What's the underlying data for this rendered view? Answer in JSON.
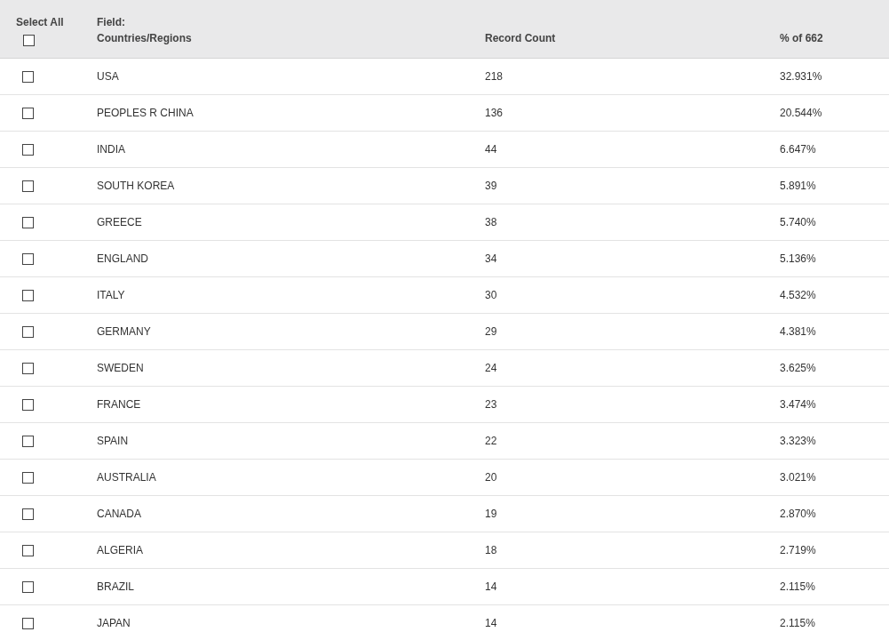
{
  "header": {
    "select_all": {
      "label": "Select All",
      "checked": false
    },
    "field_label": "Field:",
    "field_name": "Countries/Regions",
    "count_label": "Record Count",
    "percent_label": "% of 662"
  },
  "rows": [
    {
      "name": "USA",
      "count": "218",
      "percent": "32.931%",
      "checked": false
    },
    {
      "name": "PEOPLES R CHINA",
      "count": "136",
      "percent": "20.544%",
      "checked": false
    },
    {
      "name": "INDIA",
      "count": "44",
      "percent": "6.647%",
      "checked": false
    },
    {
      "name": "SOUTH KOREA",
      "count": "39",
      "percent": "5.891%",
      "checked": false
    },
    {
      "name": "GREECE",
      "count": "38",
      "percent": "5.740%",
      "checked": false
    },
    {
      "name": "ENGLAND",
      "count": "34",
      "percent": "5.136%",
      "checked": false
    },
    {
      "name": "ITALY",
      "count": "30",
      "percent": "4.532%",
      "checked": false
    },
    {
      "name": "GERMANY",
      "count": "29",
      "percent": "4.381%",
      "checked": false
    },
    {
      "name": "SWEDEN",
      "count": "24",
      "percent": "3.625%",
      "checked": false
    },
    {
      "name": "FRANCE",
      "count": "23",
      "percent": "3.474%",
      "checked": false
    },
    {
      "name": "SPAIN",
      "count": "22",
      "percent": "3.323%",
      "checked": false
    },
    {
      "name": "AUSTRALIA",
      "count": "20",
      "percent": "3.021%",
      "checked": false
    },
    {
      "name": "CANADA",
      "count": "19",
      "percent": "2.870%",
      "checked": false
    },
    {
      "name": "ALGERIA",
      "count": "18",
      "percent": "2.719%",
      "checked": false
    },
    {
      "name": "BRAZIL",
      "count": "14",
      "percent": "2.115%",
      "checked": false
    },
    {
      "name": "JAPAN",
      "count": "14",
      "percent": "2.115%",
      "checked": false
    }
  ]
}
